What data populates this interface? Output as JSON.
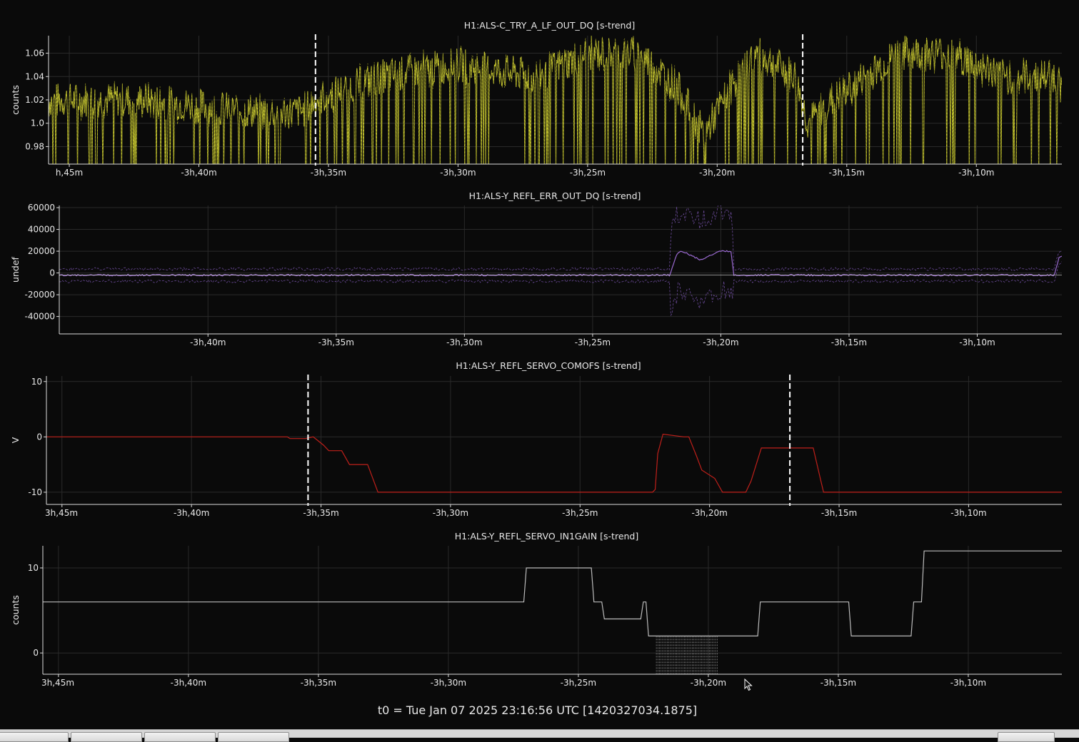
{
  "chart_data": [
    {
      "type": "line",
      "title": "H1:ALS-C_TRY_A_LF_OUT_DQ [s-trend]",
      "ylabel": "counts",
      "xlabel": "",
      "xlim": [
        -225.8,
        -186.7
      ],
      "ylim": [
        0.965,
        1.075
      ],
      "yticks": [
        0.98,
        1.0,
        1.02,
        1.04,
        1.06
      ],
      "ytick_labels": [
        "0.98",
        "1.0",
        "1.02",
        "1.04",
        "1.06"
      ],
      "xticks": [
        -225,
        -220,
        -215,
        -210,
        -205,
        -200,
        -195,
        -190
      ],
      "xtick_labels": [
        "h,45m",
        "-3h,40m",
        "-3h,35m",
        "-3h,30m",
        "-3h,25m",
        "-3h,20m",
        "-3h,15m",
        "-3h,10m"
      ],
      "grid": true,
      "color": "#c8c832",
      "vlines": [
        -215.5,
        -196.7
      ],
      "series": [
        {
          "x": [
            -225.8,
            -222,
            -218,
            -216,
            -215.5,
            -213,
            -210,
            -207,
            -205,
            -203,
            -201.5,
            -200.5,
            -199.5,
            -198.5,
            -197,
            -196.5,
            -195.5,
            -193,
            -191,
            -189,
            -187,
            -186.7
          ],
          "y": [
            1.02,
            1.02,
            1.01,
            1.01,
            1.02,
            1.04,
            1.05,
            1.04,
            1.06,
            1.06,
            1.03,
            0.99,
            1.03,
            1.06,
            1.04,
            1.0,
            1.02,
            1.06,
            1.06,
            1.04,
            1.04,
            1.03
          ]
        }
      ]
    },
    {
      "type": "line",
      "title": "H1:ALS-Y_REFL_ERR_OUT_DQ [s-trend]",
      "ylabel": "undef",
      "xlabel": "",
      "xlim": [
        -225.8,
        -186.7
      ],
      "ylim": [
        -56000,
        62000
      ],
      "yticks": [
        -40000,
        -20000,
        0,
        20000,
        40000,
        60000
      ],
      "ytick_labels": [
        "-40000",
        "-20000",
        "0",
        "20000",
        "40000",
        "60000"
      ],
      "xticks": [
        -220,
        -215,
        -210,
        -205,
        -200,
        -195,
        -190
      ],
      "xtick_labels": [
        "-3h,40m",
        "-3h,35m",
        "-3h,30m",
        "-3h,25m",
        "-3h,20m",
        "-3h,15m",
        "-3h,10m"
      ],
      "grid": true,
      "color": "#9a6ad0",
      "vlines": [],
      "series": [
        {
          "x": [
            -225.8,
            -210,
            -209,
            -202,
            -201.7,
            -201.5,
            -200.8,
            -200,
            -199.6,
            -199.5,
            -187,
            -186.8
          ],
          "y": [
            -2000,
            -2000,
            -2000,
            -2000,
            18000,
            20000,
            12000,
            20000,
            20000,
            -2000,
            -2000,
            15000
          ]
        }
      ]
    },
    {
      "type": "line",
      "title": "H1:ALS-Y_REFL_SERVO_COMOFS [s-trend]",
      "ylabel": "V",
      "xlabel": "",
      "xlim": [
        -225.6,
        -186.4
      ],
      "ylim": [
        -12.2,
        11
      ],
      "yticks": [
        -10,
        0,
        10
      ],
      "ytick_labels": [
        "-10",
        "0",
        "10"
      ],
      "xticks": [
        -225,
        -220,
        -215,
        -210,
        -205,
        -200,
        -195,
        -190
      ],
      "xtick_labels": [
        "3h,45m",
        "-3h,40m",
        "-3h,35m",
        "-3h,30m",
        "-3h,25m",
        "-3h,20m",
        "-3h,15m",
        "-3h,10m"
      ],
      "grid": true,
      "color": "#c0201a",
      "vlines": [
        -215.5,
        -196.9
      ],
      "series": [
        {
          "x": [
            -225.6,
            -216.3,
            -216.2,
            -215.6,
            -215.3,
            -214.9,
            -214.7,
            -214.2,
            -213.9,
            -213.2,
            -212.8,
            -202.2,
            -202.1,
            -202.0,
            -201.8,
            -201.0,
            -200.8,
            -200.5,
            -200.3,
            -199.8,
            -199.5,
            -198.6,
            -198.4,
            -198.0,
            -197.6,
            -196.0,
            -195.7,
            -195.6,
            -186.4
          ],
          "y": [
            0,
            0,
            -0.3,
            -0.3,
            0,
            -1.5,
            -2.5,
            -2.5,
            -5,
            -5,
            -10,
            -10,
            -9.5,
            -3,
            0.5,
            0,
            0,
            -3.5,
            -6,
            -7.5,
            -10,
            -10,
            -8,
            -2,
            -2,
            -2,
            -8,
            -10,
            -10
          ]
        }
      ]
    },
    {
      "type": "line",
      "title": "H1:ALS-Y_REFL_SERVO_IN1GAIN [s-trend]",
      "ylabel": "counts",
      "xlabel": "",
      "xlim": [
        -225.6,
        -186.4
      ],
      "ylim": [
        -2.5,
        12.6
      ],
      "yticks": [
        0,
        10
      ],
      "ytick_labels": [
        "0",
        "10"
      ],
      "xticks": [
        -225,
        -220,
        -215,
        -210,
        -205,
        -200,
        -195,
        -190
      ],
      "xtick_labels": [
        "3h,45m",
        "-3h,40m",
        "-3h,35m",
        "-3h,30m",
        "-3h,25m",
        "-3h,20m",
        "-3h,15m",
        "-3h,10m"
      ],
      "grid": true,
      "color": "#bbbbbb",
      "vlines": [],
      "series": [
        {
          "x": [
            -225.6,
            -207.8,
            -207.7,
            -207.1,
            -207.0,
            -204.5,
            -204.4,
            -204.1,
            -204.0,
            -202.6,
            -202.5,
            -202.4,
            -202.3,
            -198.1,
            -198.0,
            -194.6,
            -194.5,
            -192.2,
            -192.1,
            -191.8,
            -191.7,
            -186.5,
            -186.4
          ],
          "y": [
            6,
            6,
            6,
            6,
            10,
            10,
            6,
            6,
            4,
            4,
            6,
            6,
            2,
            2,
            6,
            6,
            2,
            2,
            6,
            6,
            12,
            12,
            12
          ]
        }
      ]
    }
  ],
  "footer": {
    "t0_label": "t0 = Tue Jan 07 2025 23:16:56 UTC [1420327034.1875]"
  },
  "colors": {
    "background": "#0a0a0a",
    "grid": "#2a2a2a",
    "axis": "#dcdcdc",
    "text": "#e8e8e8"
  }
}
